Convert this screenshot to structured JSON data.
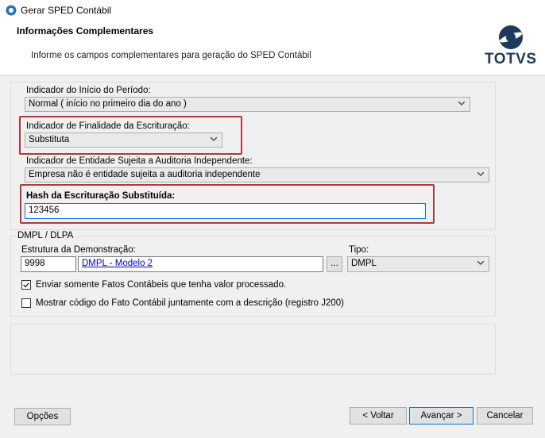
{
  "window": {
    "title": "Gerar SPED Contábil"
  },
  "header": {
    "title": "Informações Complementares",
    "description": "Informe os campos complementares para geração do SPED Contábil",
    "logo_text": "TOTVS"
  },
  "fields": {
    "inicio_periodo": {
      "label": "Indicador do Início do Período:",
      "value": "Normal ( início no primeiro dia do ano )"
    },
    "finalidade": {
      "label": "Indicador de Finalidade da Escrituração:",
      "value": "Substituta"
    },
    "entidade": {
      "label": "Indicador de Entidade Sujeita a Auditoria Independente:",
      "value": "Empresa não é entidade sujeita a auditoria independente"
    },
    "hash": {
      "label": "Hash da Escrituração Substituída:",
      "value": "123456"
    }
  },
  "dmpl": {
    "group_label": "DMPL / DLPA",
    "estrutura_label": "Estrutura da Demonstração:",
    "estrutura_code": "9998",
    "estrutura_link": "DMPL - Modelo 2",
    "browse_label": "...",
    "tipo_label": "Tipo:",
    "tipo_value": "DMPL",
    "check1": {
      "label": "Enviar somente Fatos Contábeis que tenha valor processado.",
      "checked": true
    },
    "check2": {
      "label": "Mostrar código do Fato Contábil  juntamente com a descrição (registro J200)",
      "checked": false
    }
  },
  "buttons": {
    "opcoes": "Opções",
    "voltar": "< Voltar",
    "avancar": "Avançar >",
    "cancelar": "Cancelar"
  },
  "colors": {
    "highlight_border": "#b03a3a",
    "focus_border": "#0078d7",
    "logo_navy": "#1d3a5c"
  }
}
